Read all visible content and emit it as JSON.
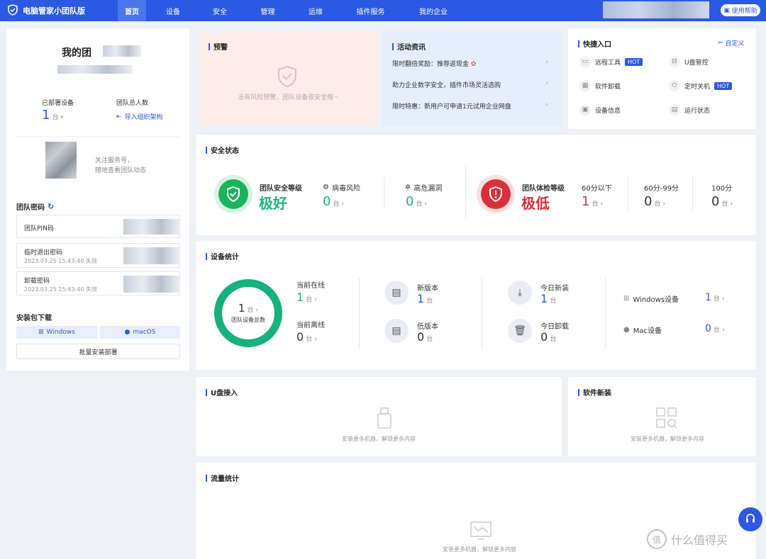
{
  "topbar": {
    "brand": "电脑管家小团队版",
    "nav": [
      "首页",
      "设备",
      "安全",
      "管理",
      "运维",
      "插件服务",
      "我的企业"
    ],
    "help": "使用帮助"
  },
  "left": {
    "team_name": "我的团",
    "deployed_label": "已部署设备",
    "deployed_value": "1",
    "deployed_unit": "台",
    "members_label": "团队总人数",
    "import_label": "导入组织架构",
    "follow_text_1": "关注服务号，",
    "follow_text_2": "随地查看团队动态",
    "pwd_title": "团队密码",
    "pin_label": "团队PIN码",
    "exit_label": "临时退出密码",
    "exit_expire": "2023.03.25 15:43:40 失效",
    "uninstall_label": "卸载密码",
    "uninstall_expire": "2023.03.25 15:43:40 失效",
    "install_title": "安装包下载",
    "windows": "Windows",
    "macos": "macOS",
    "batch": "批量安装部署"
  },
  "warning": {
    "title": "预警",
    "text": "没有风险预警，团队设备很安全哦~"
  },
  "news": {
    "title": "活动资讯",
    "items": [
      "限时翻倍奖励：推荐返现金",
      "助力企业数字安全，插件市场灵活选购",
      "限时特惠：新用户可申请1元试用企业网盘"
    ]
  },
  "quick": {
    "title": "快捷入口",
    "custom": "自定义",
    "items": [
      {
        "label": "远程工具",
        "hot": "HOT"
      },
      {
        "label": "U盘管控"
      },
      {
        "label": "软件卸载"
      },
      {
        "label": "定时关机",
        "hot": "HOT"
      },
      {
        "label": "设备信息"
      },
      {
        "label": "运行状态"
      }
    ]
  },
  "security": {
    "title": "安全状态",
    "safe_label": "团队安全等级",
    "safe_value": "极好",
    "virus_label": "病毒风险",
    "virus_value": "0",
    "vuln_label": "高危漏洞",
    "vuln_value": "0",
    "health_label": "团队体检等级",
    "health_value": "极低",
    "below60_label": "60分以下",
    "below60_value": "1",
    "mid_label": "60分-99分",
    "mid_value": "0",
    "full_label": "100分",
    "full_value": "0",
    "unit": "台",
    "colors": {
      "good": "#1bb57a",
      "bad": "#d9303a"
    }
  },
  "devices": {
    "title": "设备统计",
    "total_value": "1",
    "total_unit": "台",
    "total_label": "团队设备总数",
    "online_label": "当前在线",
    "online_value": "1",
    "offline_label": "当前离线",
    "offline_value": "0",
    "new_version_label": "新版本",
    "new_version_value": "1",
    "low_version_label": "低版本",
    "low_version_value": "0",
    "installed_today_label": "今日新装",
    "installed_today_value": "1",
    "uninstalled_today_label": "今日卸载",
    "uninstalled_today_value": "0",
    "windows_label": "Windows设备",
    "windows_value": "1",
    "mac_label": "Mac设备",
    "mac_value": "0",
    "unit": "台"
  },
  "usb": {
    "title": "U盘接入",
    "empty": "安装更多机器，解锁更多内容"
  },
  "software": {
    "title": "软件新装",
    "empty": "安装更多机器，解锁更多内容"
  },
  "traffic": {
    "title": "流量统计",
    "empty": "安装更多机器，解锁更多内容"
  },
  "watermark": "什么值得买"
}
